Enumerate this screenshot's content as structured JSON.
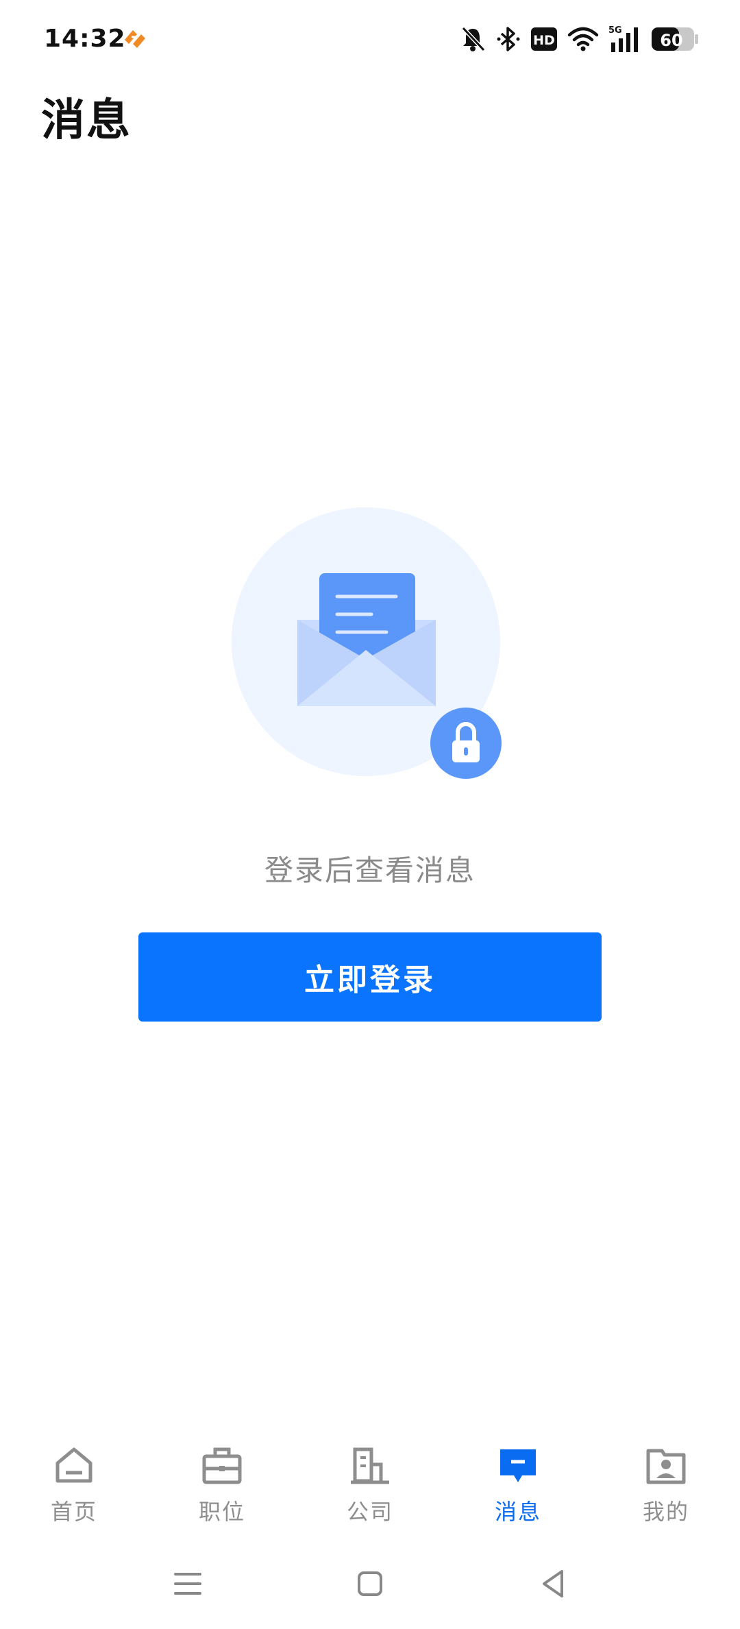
{
  "status_bar": {
    "time": "14:32",
    "battery": "60",
    "network": "5G",
    "hd_label": "HD",
    "icons": [
      "app-notification-icon",
      "mute-bell-icon",
      "bluetooth-icon",
      "hd-icon",
      "wifi-icon",
      "signal-icon",
      "battery-icon"
    ]
  },
  "header": {
    "title": "消息"
  },
  "empty_state": {
    "illustration": "envelope-lock-icon",
    "message": "登录后查看消息",
    "button_label": "立即登录"
  },
  "bottom_nav": {
    "active_index": 3,
    "items": [
      {
        "label": "首页",
        "icon": "home-icon"
      },
      {
        "label": "职位",
        "icon": "briefcase-icon"
      },
      {
        "label": "公司",
        "icon": "building-icon"
      },
      {
        "label": "消息",
        "icon": "message-icon"
      },
      {
        "label": "我的",
        "icon": "profile-icon"
      }
    ]
  },
  "system_nav": {
    "icons": [
      "menu-icon",
      "home-square-icon",
      "back-icon"
    ]
  },
  "colors": {
    "accent": "#0a74ff",
    "active_nav": "#0a6cf0",
    "inactive_nav": "#8e8e8e",
    "illustration_bg": "#eef5fe",
    "envelope_blue": "#5a97f8",
    "app_icon_orange": "#f08a24"
  }
}
